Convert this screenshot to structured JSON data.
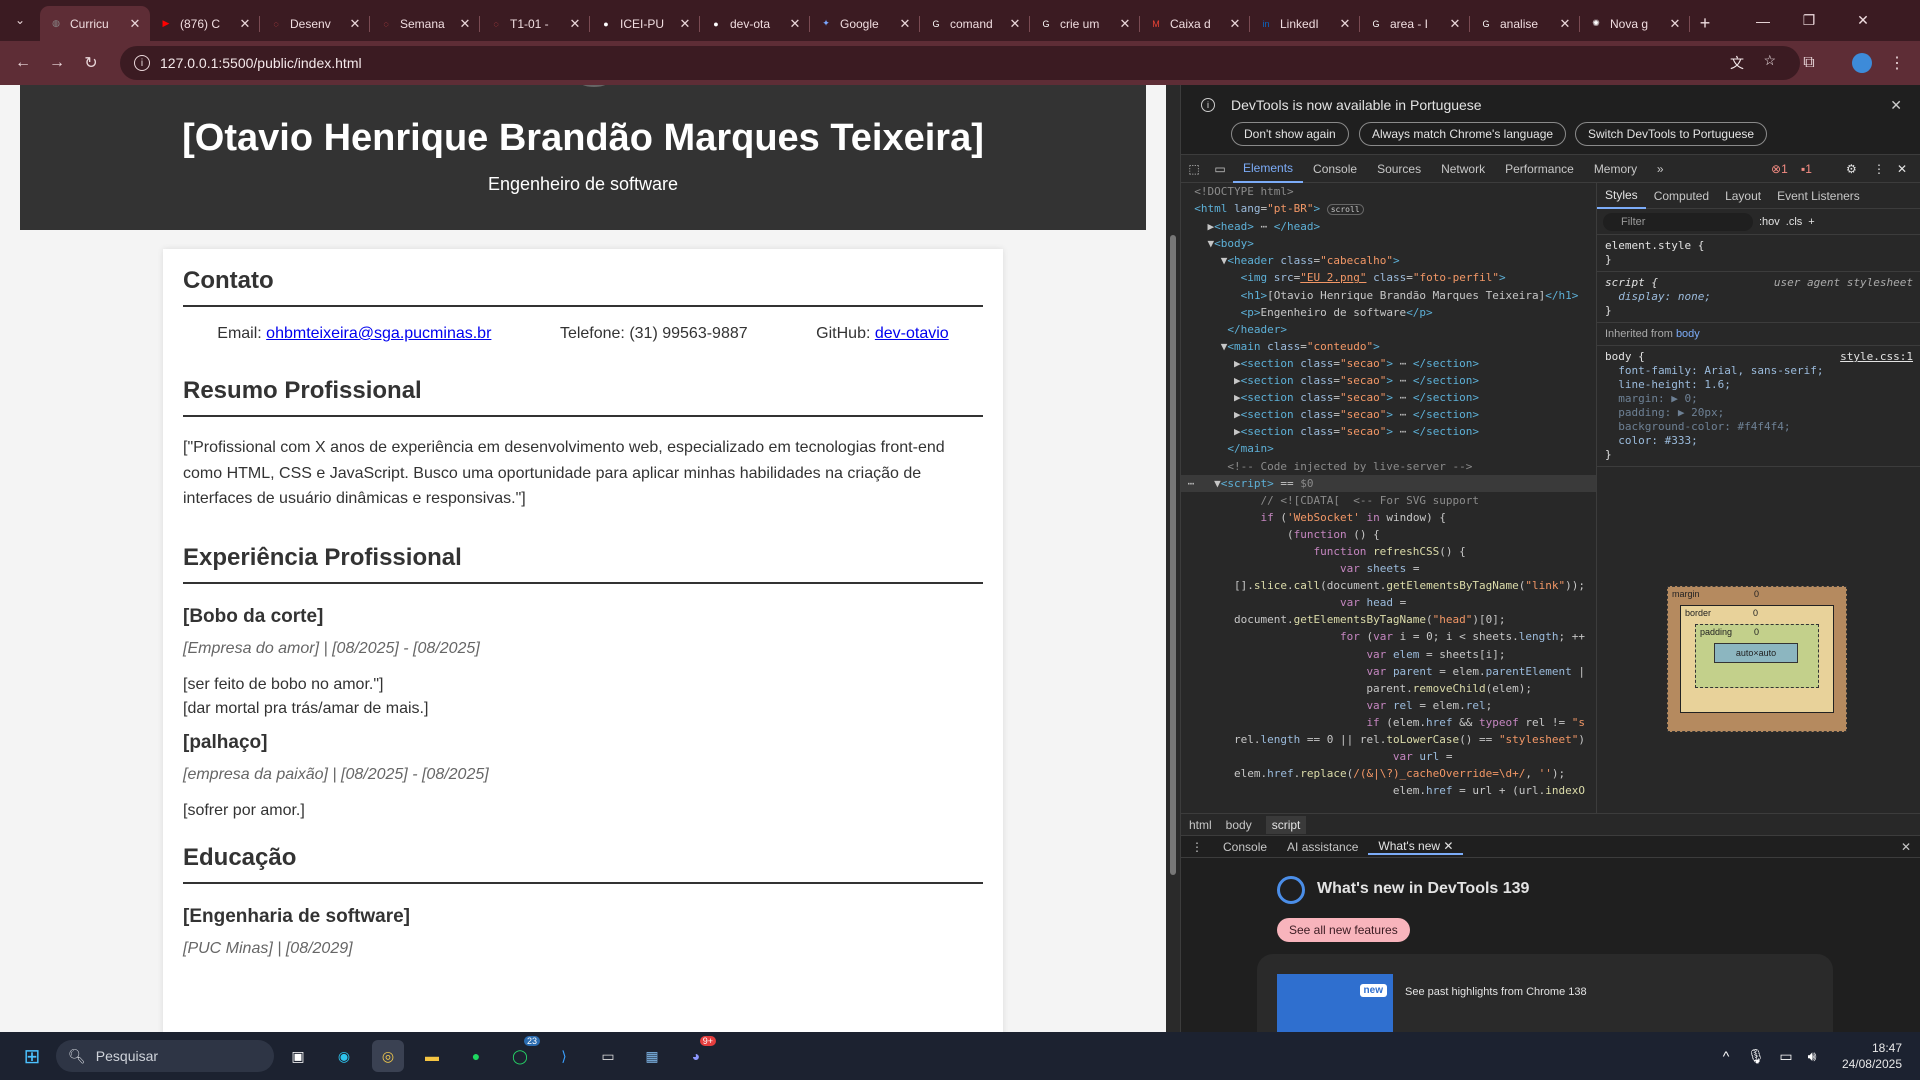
{
  "browser": {
    "tabs": [
      {
        "title": "Curricu",
        "favicon": "globe-icon",
        "color": "#8a8a8a",
        "active": true
      },
      {
        "title": "(876) C",
        "favicon": "youtube-icon",
        "color": "#ff0000"
      },
      {
        "title": "Desenv",
        "favicon": "loading-icon",
        "color": "#ff5555"
      },
      {
        "title": "Semana",
        "favicon": "loading-icon",
        "color": "#ff5555"
      },
      {
        "title": "T1-01 -",
        "favicon": "loading-icon",
        "color": "#ff5555"
      },
      {
        "title": "ICEI-PU",
        "favicon": "github-icon",
        "color": "#ffffff"
      },
      {
        "title": "dev-ota",
        "favicon": "github-icon",
        "color": "#ffffff"
      },
      {
        "title": "Google",
        "favicon": "gemini-icon",
        "color": "#7aa7ff"
      },
      {
        "title": "comand",
        "favicon": "google-icon",
        "color": "#ffffff"
      },
      {
        "title": "crie um",
        "favicon": "google-icon",
        "color": "#ffffff"
      },
      {
        "title": "Caixa d",
        "favicon": "gmail-icon",
        "color": "#ea4335"
      },
      {
        "title": "LinkedI",
        "favicon": "linkedin-icon",
        "color": "#0a66c2"
      },
      {
        "title": "area - I",
        "favicon": "google-icon",
        "color": "#ffffff"
      },
      {
        "title": "analise",
        "favicon": "google-icon",
        "color": "#ffffff"
      },
      {
        "title": "Nova g",
        "favicon": "chatgpt-icon",
        "color": "#ffffff"
      }
    ],
    "url": "127.0.0.1:5500/public/index.html"
  },
  "cv": {
    "name": "[Otavio Henrique Brandão Marques Teixeira]",
    "role": "Engenheiro de software",
    "contato": {
      "title": "Contato",
      "email_label": "Email:",
      "email": "ohbmteixeira@sga.pucminas.br",
      "phone": "Telefone: (31) 99563-9887",
      "github_label": "GitHub:",
      "github": "dev-otavio"
    },
    "resumo": {
      "title": "Resumo Profissional",
      "text": "[\"Profissional com X anos de experiência em desenvolvimento web, especializado em tecnologias front-end como HTML, CSS e JavaScript. Busco uma oportunidade para aplicar minhas habilidades na criação de interfaces de usuário dinâmicas e responsivas.\"]"
    },
    "experiencia": {
      "title": "Experiência Profissional",
      "jobs": [
        {
          "title": "[Bobo da corte]",
          "meta": "[Empresa do amor] | [08/2025] - [08/2025]",
          "lines": [
            "[ser feito de bobo no amor.\"]",
            "[dar mortal pra trás/amar de mais.]"
          ]
        },
        {
          "title": "[palhaço]",
          "meta": "[empresa da paixão] | [08/2025] - [08/2025]",
          "lines": [
            "[sofrer por amor.]"
          ]
        }
      ]
    },
    "educacao": {
      "title": "Educação",
      "course": "[Engenharia de software]",
      "meta": "[PUC Minas] | [08/2029]"
    }
  },
  "devtools": {
    "banner": "DevTools is now available in Portuguese",
    "btn_dont_show": "Don't show again",
    "btn_match": "Always match Chrome's language",
    "btn_switch": "Switch DevTools to Portuguese",
    "tabs": [
      "Elements",
      "Console",
      "Sources",
      "Network",
      "Performance",
      "Memory"
    ],
    "errors": "1",
    "warnings": "1",
    "styles_tabs": [
      "Styles",
      "Computed",
      "Layout",
      "Event Listeners"
    ],
    "filter_placeholder": "Filter",
    "filter_tools": [
      ":hov",
      ".cls"
    ],
    "breadcrumb": [
      "html",
      "body",
      "script"
    ],
    "drawer_tabs": [
      "Console",
      "AI assistance",
      "What's new"
    ],
    "whats_new_title": "What's new in DevTools 139",
    "whats_new_btn": "See all new features",
    "whats_new_badge": "new",
    "whats_new_past": "See past highlights from Chrome 138",
    "styles": {
      "element_style": "element.style {",
      "script_rule": "script {",
      "ua": "user agent stylesheet",
      "display": "display: none;",
      "inherited": "Inherited from",
      "inherited_el": "body",
      "body_rule": "body {",
      "source": "style.css:1",
      "props": [
        "font-family: Arial, sans-serif;",
        "line-height: 1.6;",
        "margin: ▶ 0;",
        "padding: ▶ 20px;",
        "background-color: #f4f4f4;",
        "color: #333;"
      ]
    },
    "boxmodel": {
      "margin": "margin",
      "border": "border",
      "padding": "padding",
      "content": "auto×auto",
      "zero": "0"
    }
  },
  "taskbar": {
    "search": "Pesquisar",
    "time": "18:47",
    "date": "24/08/2025",
    "whatsapp_badge": "23",
    "discord_badge": "9+"
  }
}
